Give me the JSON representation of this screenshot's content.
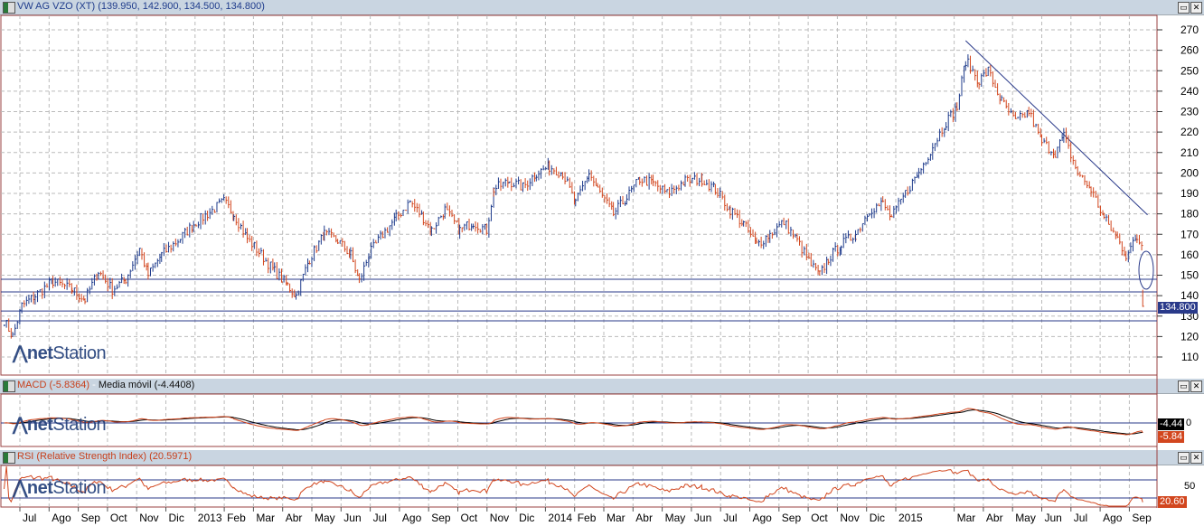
{
  "window": {
    "title": "VW AG VZO (XT) (139.950, 142.900, 134.500, 134.800)"
  },
  "macd_panel": {
    "title_macd": "MACD (-5.8364)",
    "separator": " - ",
    "title_ma": "Media móvil (-4.4408)",
    "zero_label": "0",
    "ma_tag": "-4.44",
    "macd_tag": "-5.84"
  },
  "rsi_panel": {
    "title": "RSI (Relative Strength Index) (20.5971)",
    "level_label": "50",
    "rsi_tag": "20.60",
    "levels": [
      70,
      30
    ]
  },
  "logo": {
    "text_net": "net",
    "text_station": "Station"
  },
  "colors": {
    "up": "#1f3c8c",
    "down": "#d2461e",
    "frame": "#9a4040",
    "line": "#2a3a8a"
  },
  "chart_data": {
    "type": "ohlc",
    "title": "VW AG VZO (XT)",
    "last": {
      "open": 139.95,
      "high": 142.9,
      "low": 134.5,
      "close": 134.8
    },
    "last_label": "134.800",
    "ylim": [
      103,
      275
    ],
    "yticks": [
      110,
      120,
      130,
      140,
      150,
      160,
      170,
      180,
      190,
      200,
      210,
      220,
      230,
      240,
      250,
      260,
      270
    ],
    "xticks": [
      "Jul",
      "Ago",
      "Sep",
      "Oct",
      "Nov",
      "Dic",
      "2013",
      "Feb",
      "Mar",
      "Abr",
      "May",
      "Jun",
      "Jul",
      "Ago",
      "Sep",
      "Oct",
      "Nov",
      "Dic",
      "2014",
      "Feb",
      "Mar",
      "Abr",
      "May",
      "Jun",
      "Jul",
      "Ago",
      "Sep",
      "Oct",
      "Nov",
      "Dic",
      "2015",
      "Mar",
      "Abr",
      "May",
      "Jun",
      "Jul",
      "Ago",
      "Sep"
    ],
    "grid": true,
    "horizontal_lines": [
      148,
      141.8,
      132.5,
      127.7
    ],
    "trendline": [
      [
        "2015-03-13",
        264.7
      ],
      [
        "2015-09-20",
        179.5
      ]
    ],
    "closes": [
      [
        "2012-06-15",
        128
      ],
      [
        "2012-06-24",
        120
      ],
      [
        "2012-07-03",
        135
      ],
      [
        "2012-07-17",
        140
      ],
      [
        "2012-08-05",
        147
      ],
      [
        "2012-08-25",
        143
      ],
      [
        "2012-09-08",
        138
      ],
      [
        "2012-09-22",
        152
      ],
      [
        "2012-10-06",
        143
      ],
      [
        "2012-10-20",
        148
      ],
      [
        "2012-11-04",
        163
      ],
      [
        "2012-11-13",
        150
      ],
      [
        "2012-11-27",
        160
      ],
      [
        "2012-12-16",
        168
      ],
      [
        "2012-12-30",
        175
      ],
      [
        "2013-01-14",
        180
      ],
      [
        "2013-01-31",
        186
      ],
      [
        "2013-02-11",
        180
      ],
      [
        "2013-02-25",
        168
      ],
      [
        "2013-03-09",
        160
      ],
      [
        "2013-03-23",
        152
      ],
      [
        "2013-04-06",
        145
      ],
      [
        "2013-04-15",
        140
      ],
      [
        "2013-04-29",
        158
      ],
      [
        "2013-05-14",
        170
      ],
      [
        "2013-05-28",
        167
      ],
      [
        "2013-06-11",
        160
      ],
      [
        "2013-06-20",
        147
      ],
      [
        "2013-06-30",
        160
      ],
      [
        "2013-07-14",
        170
      ],
      [
        "2013-07-28",
        178
      ],
      [
        "2013-08-12",
        186
      ],
      [
        "2013-08-26",
        178
      ],
      [
        "2013-09-04",
        172
      ],
      [
        "2013-09-18",
        182
      ],
      [
        "2013-10-03",
        172
      ],
      [
        "2013-10-17",
        176
      ],
      [
        "2013-10-31",
        172
      ],
      [
        "2013-11-08",
        192
      ],
      [
        "2013-11-24",
        196
      ],
      [
        "2013-12-08",
        193
      ],
      [
        "2013-12-22",
        200
      ],
      [
        "2014-01-05",
        203
      ],
      [
        "2014-01-19",
        200
      ],
      [
        "2014-02-02",
        185
      ],
      [
        "2014-02-16",
        200
      ],
      [
        "2014-02-25",
        192
      ],
      [
        "2014-03-11",
        180
      ],
      [
        "2014-03-25",
        188
      ],
      [
        "2014-04-08",
        197
      ],
      [
        "2014-04-22",
        195
      ],
      [
        "2014-05-06",
        190
      ],
      [
        "2014-05-25",
        196
      ],
      [
        "2014-06-12",
        197
      ],
      [
        "2014-06-26",
        192
      ],
      [
        "2014-07-11",
        182
      ],
      [
        "2014-07-25",
        175
      ],
      [
        "2014-08-08",
        165
      ],
      [
        "2014-08-22",
        170
      ],
      [
        "2014-09-06",
        176
      ],
      [
        "2014-09-20",
        167
      ],
      [
        "2014-10-04",
        155
      ],
      [
        "2014-10-13",
        150
      ],
      [
        "2014-10-22",
        158
      ],
      [
        "2014-11-05",
        165
      ],
      [
        "2014-11-20",
        170
      ],
      [
        "2014-12-04",
        182
      ],
      [
        "2014-12-18",
        185
      ],
      [
        "2014-12-27",
        178
      ],
      [
        "2015-01-11",
        190
      ],
      [
        "2015-01-25",
        200
      ],
      [
        "2015-02-09",
        213
      ],
      [
        "2015-02-23",
        225
      ],
      [
        "2015-03-04",
        232
      ],
      [
        "2015-03-13",
        255
      ],
      [
        "2015-03-27",
        245
      ],
      [
        "2015-04-06",
        250
      ],
      [
        "2015-04-20",
        235
      ],
      [
        "2015-05-04",
        225
      ],
      [
        "2015-05-18",
        230
      ],
      [
        "2015-06-01",
        215
      ],
      [
        "2015-06-15",
        210
      ],
      [
        "2015-06-24",
        218
      ],
      [
        "2015-07-08",
        200
      ],
      [
        "2015-07-22",
        192
      ],
      [
        "2015-08-05",
        178
      ],
      [
        "2015-08-19",
        168
      ],
      [
        "2015-08-28",
        160
      ],
      [
        "2015-09-09",
        168
      ],
      [
        "2015-09-14",
        165
      ],
      [
        "2015-09-15",
        134.8
      ]
    ]
  }
}
